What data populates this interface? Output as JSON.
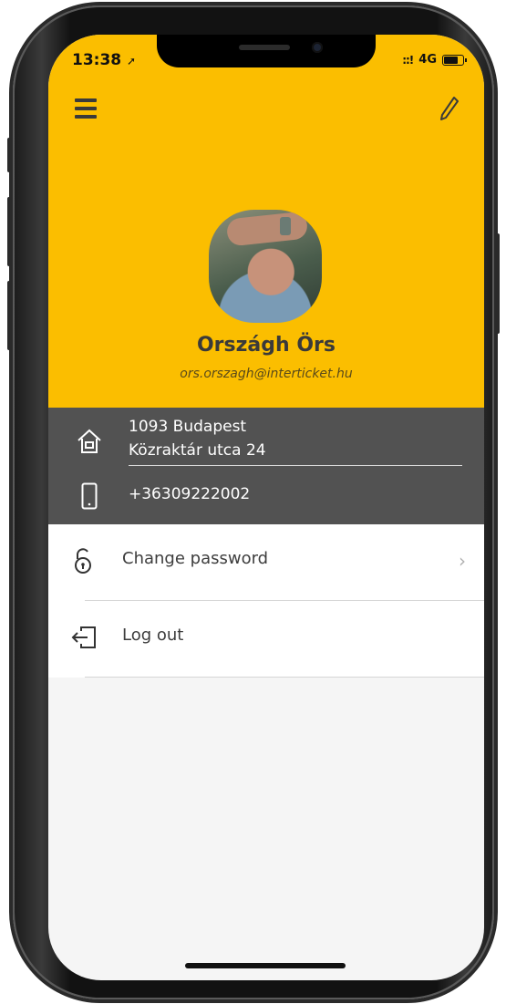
{
  "status_bar": {
    "time": "13:38",
    "network": "4G",
    "location_icon": "location-arrow-icon",
    "signal_icon": "signal-bars-icon",
    "battery_icon": "battery-icon"
  },
  "header": {
    "menu_icon": "hamburger-menu-icon",
    "edit_icon": "pencil-edit-icon",
    "background_color": "#fbbe00"
  },
  "profile": {
    "name": "Országh Örs",
    "email": "ors.orszagh@interticket.hu"
  },
  "contact": {
    "address_line1": "1093 Budapest",
    "address_line2": "Közraktár utca 24",
    "phone": "+36309222002",
    "background_color": "#525252"
  },
  "menu": {
    "change_password": "Change password",
    "log_out": "Log out"
  }
}
